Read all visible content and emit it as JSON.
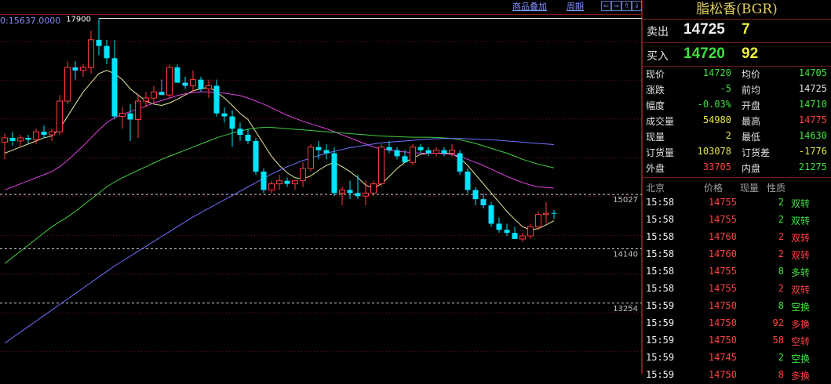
{
  "toolbar": {
    "link1": "商品叠加",
    "link2": "周期",
    "nav": [
      "⇐",
      "⇒",
      "⇑",
      "⇓"
    ]
  },
  "info": {
    "readout": "0:15637.0000"
  },
  "chart_data": {
    "type": "candlestick",
    "ylim": [
      12100,
      18200
    ],
    "y_ticks": [
      {
        "label": "15027",
        "value": 15027
      },
      {
        "label": "14140",
        "value": 14140
      },
      {
        "label": "13254",
        "value": 13254
      }
    ],
    "max_marker": {
      "label": "17900",
      "value": 17900
    },
    "candles": [
      {
        "o": 15880,
        "h": 16020,
        "l": 15600,
        "c": 15950
      },
      {
        "o": 15950,
        "h": 16050,
        "l": 15820,
        "c": 15900
      },
      {
        "o": 15900,
        "h": 16000,
        "l": 15800,
        "c": 15950
      },
      {
        "o": 15950,
        "h": 16000,
        "l": 15850,
        "c": 15920
      },
      {
        "o": 15920,
        "h": 16100,
        "l": 15850,
        "c": 16050
      },
      {
        "o": 16050,
        "h": 16150,
        "l": 15950,
        "c": 16000
      },
      {
        "o": 16000,
        "h": 16100,
        "l": 15900,
        "c": 16050
      },
      {
        "o": 16050,
        "h": 16650,
        "l": 16000,
        "c": 16550
      },
      {
        "o": 16550,
        "h": 17200,
        "l": 16500,
        "c": 17100
      },
      {
        "o": 17100,
        "h": 17200,
        "l": 16900,
        "c": 17050
      },
      {
        "o": 17050,
        "h": 17150,
        "l": 16950,
        "c": 17100
      },
      {
        "o": 17100,
        "h": 17700,
        "l": 17000,
        "c": 17550
      },
      {
        "o": 17550,
        "h": 17900,
        "l": 17300,
        "c": 17450
      },
      {
        "o": 17450,
        "h": 17550,
        "l": 17150,
        "c": 17250
      },
      {
        "o": 17250,
        "h": 17550,
        "l": 16250,
        "c": 16300
      },
      {
        "o": 16300,
        "h": 16450,
        "l": 16100,
        "c": 16350
      },
      {
        "o": 16350,
        "h": 16500,
        "l": 15900,
        "c": 16250
      },
      {
        "o": 16250,
        "h": 16650,
        "l": 15950,
        "c": 16550
      },
      {
        "o": 16550,
        "h": 16700,
        "l": 16450,
        "c": 16600
      },
      {
        "o": 16600,
        "h": 16800,
        "l": 16500,
        "c": 16700
      },
      {
        "o": 16700,
        "h": 16900,
        "l": 16650,
        "c": 16650
      },
      {
        "o": 16650,
        "h": 17150,
        "l": 16600,
        "c": 17100
      },
      {
        "o": 17100,
        "h": 17150,
        "l": 16850,
        "c": 16850
      },
      {
        "o": 16850,
        "h": 16950,
        "l": 16750,
        "c": 16800
      },
      {
        "o": 16800,
        "h": 17050,
        "l": 16700,
        "c": 16900
      },
      {
        "o": 16900,
        "h": 16950,
        "l": 16700,
        "c": 16750
      },
      {
        "o": 16750,
        "h": 16900,
        "l": 16600,
        "c": 16800
      },
      {
        "o": 16800,
        "h": 16900,
        "l": 16300,
        "c": 16350
      },
      {
        "o": 16350,
        "h": 16450,
        "l": 16200,
        "c": 16300
      },
      {
        "o": 16300,
        "h": 16400,
        "l": 15800,
        "c": 16100
      },
      {
        "o": 16100,
        "h": 16200,
        "l": 15900,
        "c": 16000
      },
      {
        "o": 16000,
        "h": 16100,
        "l": 15850,
        "c": 15900
      },
      {
        "o": 15900,
        "h": 15950,
        "l": 15350,
        "c": 15400
      },
      {
        "o": 15400,
        "h": 15450,
        "l": 15050,
        "c": 15100
      },
      {
        "o": 15100,
        "h": 15250,
        "l": 15050,
        "c": 15200
      },
      {
        "o": 15200,
        "h": 15350,
        "l": 15100,
        "c": 15250
      },
      {
        "o": 15250,
        "h": 15300,
        "l": 15150,
        "c": 15200
      },
      {
        "o": 15200,
        "h": 15250,
        "l": 15100,
        "c": 15250
      },
      {
        "o": 15250,
        "h": 15550,
        "l": 15150,
        "c": 15450
      },
      {
        "o": 15450,
        "h": 15850,
        "l": 15400,
        "c": 15800
      },
      {
        "o": 15800,
        "h": 15900,
        "l": 15600,
        "c": 15750
      },
      {
        "o": 15750,
        "h": 15850,
        "l": 15600,
        "c": 15700
      },
      {
        "o": 15700,
        "h": 15800,
        "l": 15000,
        "c": 15050
      },
      {
        "o": 15050,
        "h": 15150,
        "l": 14850,
        "c": 15100
      },
      {
        "o": 15100,
        "h": 15250,
        "l": 14950,
        "c": 15050
      },
      {
        "o": 15050,
        "h": 15350,
        "l": 14950,
        "c": 15000
      },
      {
        "o": 15000,
        "h": 15250,
        "l": 14850,
        "c": 15050
      },
      {
        "o": 15050,
        "h": 15250,
        "l": 15000,
        "c": 15200
      },
      {
        "o": 15200,
        "h": 15850,
        "l": 15150,
        "c": 15800
      },
      {
        "o": 15800,
        "h": 15900,
        "l": 15700,
        "c": 15750
      },
      {
        "o": 15750,
        "h": 15800,
        "l": 15600,
        "c": 15650
      },
      {
        "o": 15650,
        "h": 15750,
        "l": 15550,
        "c": 15550
      },
      {
        "o": 15550,
        "h": 15850,
        "l": 15500,
        "c": 15800
      },
      {
        "o": 15800,
        "h": 15850,
        "l": 15700,
        "c": 15750
      },
      {
        "o": 15750,
        "h": 15800,
        "l": 15650,
        "c": 15700
      },
      {
        "o": 15700,
        "h": 15800,
        "l": 15650,
        "c": 15750
      },
      {
        "o": 15750,
        "h": 15800,
        "l": 15650,
        "c": 15700
      },
      {
        "o": 15700,
        "h": 15850,
        "l": 15650,
        "c": 15750
      },
      {
        "o": 15700,
        "h": 15750,
        "l": 15350,
        "c": 15400
      },
      {
        "o": 15400,
        "h": 15450,
        "l": 15050,
        "c": 15100
      },
      {
        "o": 15100,
        "h": 15150,
        "l": 14850,
        "c": 14950
      },
      {
        "o": 14950,
        "h": 15050,
        "l": 14800,
        "c": 14850
      },
      {
        "o": 14850,
        "h": 14900,
        "l": 14500,
        "c": 14550
      },
      {
        "o": 14550,
        "h": 14650,
        "l": 14400,
        "c": 14450
      },
      {
        "o": 14450,
        "h": 14550,
        "l": 14350,
        "c": 14400
      },
      {
        "o": 14400,
        "h": 14500,
        "l": 14300,
        "c": 14300
      },
      {
        "o": 14300,
        "h": 14400,
        "l": 14250,
        "c": 14350
      },
      {
        "o": 14350,
        "h": 14550,
        "l": 14300,
        "c": 14500
      },
      {
        "o": 14500,
        "h": 14750,
        "l": 14450,
        "c": 14700
      },
      {
        "o": 14700,
        "h": 14900,
        "l": 14550,
        "c": 14720
      },
      {
        "o": 14725,
        "h": 14775,
        "l": 14630,
        "c": 14720
      }
    ],
    "ma_lines": [
      {
        "color": "#e8e8a0",
        "values": [
          15700,
          15750,
          15800,
          15850,
          15900,
          15950,
          15980,
          16100,
          16300,
          16500,
          16700,
          16850,
          17000,
          17050,
          17000,
          16900,
          16750,
          16650,
          16550,
          16500,
          16480,
          16520,
          16580,
          16650,
          16720,
          16750,
          16780,
          16700,
          16600,
          16480,
          16350,
          16250,
          16050,
          15850,
          15650,
          15500,
          15380,
          15300,
          15280,
          15330,
          15420,
          15500,
          15550,
          15480,
          15400,
          15300,
          15180,
          15130,
          15200,
          15320,
          15450,
          15550,
          15620,
          15680,
          15700,
          15700,
          15700,
          15690,
          15620,
          15500,
          15350,
          15200,
          15050,
          14900,
          14750,
          14620,
          14500,
          14450,
          14470,
          14530,
          14600
        ]
      },
      {
        "color": "#e040e0",
        "values": [
          15100,
          15150,
          15200,
          15250,
          15300,
          15350,
          15400,
          15480,
          15580,
          15700,
          15820,
          15950,
          16080,
          16200,
          16280,
          16330,
          16380,
          16420,
          16470,
          16520,
          16560,
          16600,
          16640,
          16670,
          16690,
          16700,
          16700,
          16690,
          16680,
          16660,
          16640,
          16600,
          16550,
          16500,
          16440,
          16380,
          16320,
          16270,
          16220,
          16180,
          16140,
          16100,
          16050,
          16000,
          15950,
          15900,
          15850,
          15800,
          15770,
          15750,
          15730,
          15720,
          15710,
          15700,
          15700,
          15700,
          15690,
          15680,
          15650,
          15600,
          15550,
          15500,
          15440,
          15380,
          15320,
          15270,
          15220,
          15180,
          15150,
          15140,
          15130
        ]
      },
      {
        "color": "#40d040",
        "values": [
          13900,
          14000,
          14100,
          14200,
          14300,
          14400,
          14500,
          14580,
          14660,
          14750,
          14850,
          14950,
          15050,
          15150,
          15230,
          15300,
          15360,
          15420,
          15480,
          15540,
          15600,
          15650,
          15700,
          15750,
          15800,
          15850,
          15900,
          15950,
          15990,
          16030,
          16060,
          16090,
          16110,
          16120,
          16120,
          16110,
          16100,
          16090,
          16080,
          16070,
          16060,
          16050,
          16040,
          16030,
          16020,
          16010,
          16000,
          15990,
          15980,
          15975,
          15970,
          15965,
          15960,
          15960,
          15960,
          15955,
          15950,
          15940,
          15920,
          15890,
          15860,
          15820,
          15780,
          15740,
          15700,
          15650,
          15600,
          15560,
          15520,
          15490,
          15460
        ]
      },
      {
        "color": "#7070ff",
        "values": [
          12600,
          12690,
          12780,
          12870,
          12960,
          13050,
          13140,
          13230,
          13320,
          13410,
          13500,
          13590,
          13680,
          13770,
          13860,
          13940,
          14020,
          14100,
          14180,
          14260,
          14340,
          14420,
          14500,
          14580,
          14660,
          14730,
          14800,
          14870,
          14940,
          15010,
          15080,
          15150,
          15220,
          15290,
          15360,
          15420,
          15480,
          15530,
          15580,
          15620,
          15660,
          15700,
          15730,
          15760,
          15790,
          15810,
          15830,
          15850,
          15870,
          15880,
          15890,
          15900,
          15910,
          15920,
          15930,
          15935,
          15940,
          15940,
          15940,
          15935,
          15930,
          15925,
          15920,
          15910,
          15900,
          15890,
          15880,
          15870,
          15860,
          15850,
          15840
        ]
      }
    ]
  },
  "panel": {
    "title": "脂松香(BGR)",
    "sell": {
      "label": "卖出",
      "price": "14725",
      "vol": "7"
    },
    "buy": {
      "label": "买入",
      "price": "14720",
      "vol": "92"
    },
    "stats": [
      {
        "l1": "现价",
        "v1": "14720",
        "c1": "#40e040",
        "l2": "均价",
        "v2": "14705",
        "c2": "#40e040"
      },
      {
        "l1": "涨跌",
        "v1": "-5",
        "c1": "#40e040",
        "l2": "前均",
        "v2": "14725",
        "c2": "#e0e0e0"
      },
      {
        "l1": "幅度",
        "v1": "-0.03%",
        "c1": "#40e040",
        "l2": "开盘",
        "v2": "14710",
        "c2": "#40e040"
      },
      {
        "l1": "成交量",
        "v1": "54980",
        "c1": "#e8e840",
        "l2": "最高",
        "v2": "14775",
        "c2": "#ff4040"
      },
      {
        "l1": "现量",
        "v1": "2",
        "c1": "#e8e840",
        "l2": "最低",
        "v2": "14630",
        "c2": "#40e040"
      },
      {
        "l1": "订货量",
        "v1": "103078",
        "c1": "#e8e840",
        "l2": "订货差",
        "v2": "-1776",
        "c2": "#e8e840"
      },
      {
        "l1": "外盘",
        "v1": "33705",
        "c1": "#ff4040",
        "l2": "内盘",
        "v2": "21275",
        "c2": "#40e040"
      }
    ],
    "ticks_header": {
      "time": "北京",
      "price": "价格",
      "vol": "现量",
      "nature": "性质"
    },
    "ticks": [
      {
        "time": "15:58",
        "price": "14755",
        "vol": "2",
        "vol_color": "#40e040",
        "nature": "双转",
        "nature_color": "#40e040"
      },
      {
        "time": "15:58",
        "price": "14755",
        "vol": "2",
        "vol_color": "#40e040",
        "nature": "双转",
        "nature_color": "#40e040"
      },
      {
        "time": "15:58",
        "price": "14760",
        "vol": "2",
        "vol_color": "#ff4040",
        "nature": "双转",
        "nature_color": "#ff4040"
      },
      {
        "time": "15:58",
        "price": "14760",
        "vol": "2",
        "vol_color": "#ff4040",
        "nature": "双转",
        "nature_color": "#ff4040"
      },
      {
        "time": "15:58",
        "price": "14755",
        "vol": "8",
        "vol_color": "#40e040",
        "nature": "多转",
        "nature_color": "#40e040"
      },
      {
        "time": "15:58",
        "price": "14755",
        "vol": "2",
        "vol_color": "#ff4040",
        "nature": "双转",
        "nature_color": "#ff4040"
      },
      {
        "time": "15:59",
        "price": "14750",
        "vol": "8",
        "vol_color": "#40e040",
        "nature": "空换",
        "nature_color": "#40e040"
      },
      {
        "time": "15:59",
        "price": "14750",
        "vol": "92",
        "vol_color": "#ff4040",
        "nature": "多换",
        "nature_color": "#ff4040"
      },
      {
        "time": "15:59",
        "price": "14750",
        "vol": "58",
        "vol_color": "#ff4040",
        "nature": "空转",
        "nature_color": "#ff4040"
      },
      {
        "time": "15:59",
        "price": "14745",
        "vol": "2",
        "vol_color": "#40e040",
        "nature": "空换",
        "nature_color": "#40e040"
      },
      {
        "time": "15:59",
        "price": "14750",
        "vol": "8",
        "vol_color": "#ff4040",
        "nature": "多换",
        "nature_color": "#ff4040"
      }
    ]
  }
}
